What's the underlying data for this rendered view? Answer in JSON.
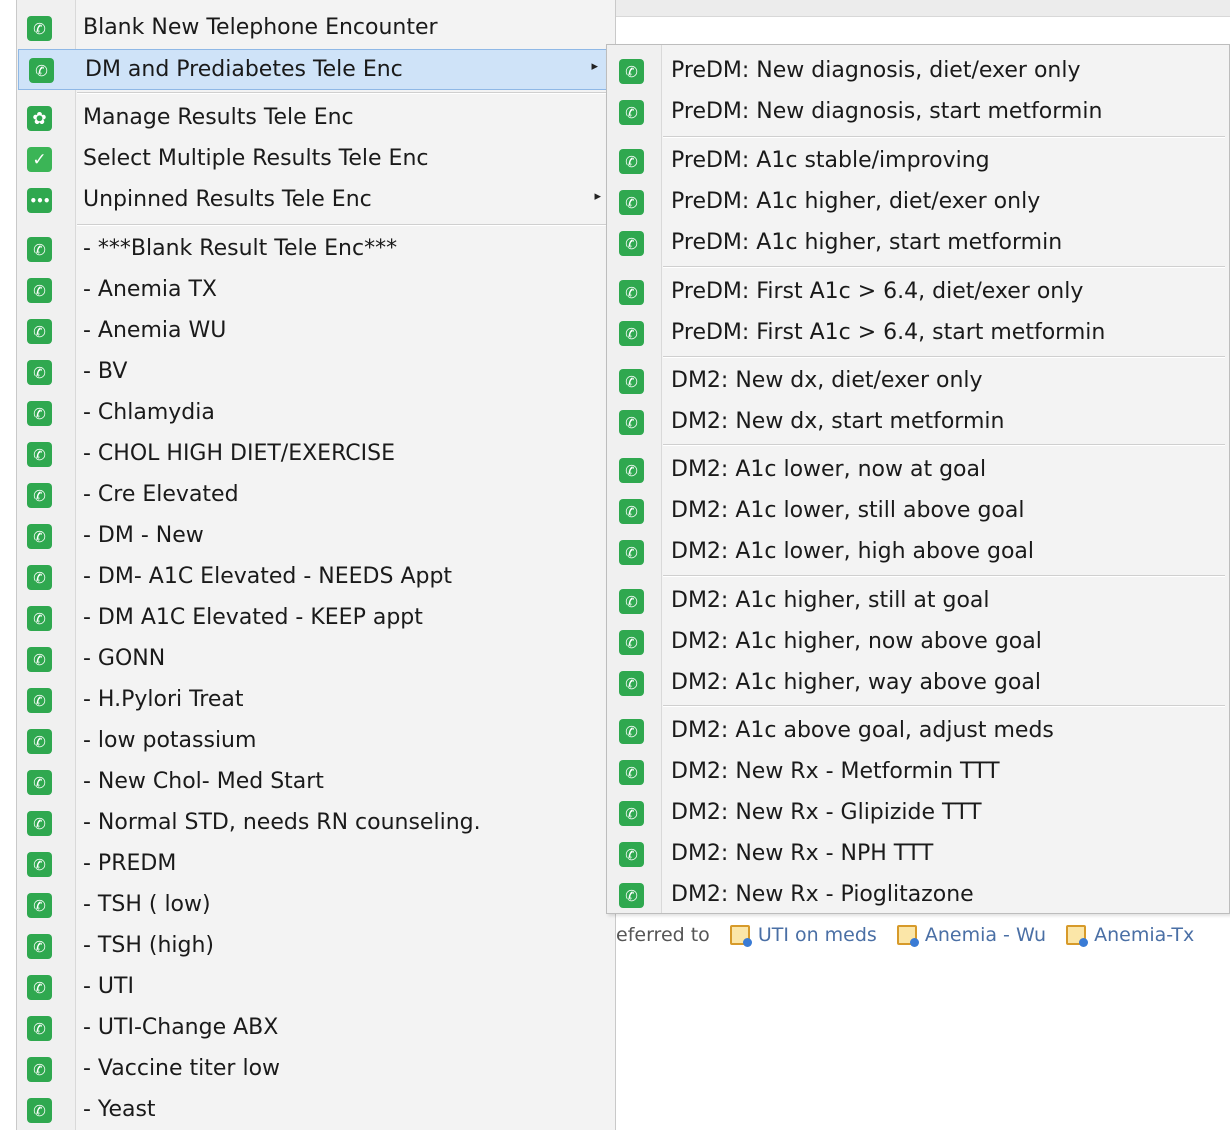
{
  "background": {
    "partial_text": "eferred to",
    "quick_items": [
      {
        "label": "UTI on meds"
      },
      {
        "label": "Anemia - Wu"
      },
      {
        "label": "Anemia-Tx"
      }
    ]
  },
  "menu": {
    "items": [
      {
        "label": "Blank New Telephone Encounter",
        "icon": "phone-icon"
      },
      {
        "label": "DM and Prediabetes Tele Enc",
        "icon": "phone-icon",
        "highlighted": true,
        "submenu_arrow": "▸"
      },
      {
        "label": "Manage Results Tele Enc",
        "icon": "gear-icon"
      },
      {
        "label": "Select Multiple Results Tele Enc",
        "icon": "check-icon"
      },
      {
        "label": "Unpinned Results Tele Enc",
        "icon": "dots-icon",
        "submenu_arrow": "▸"
      },
      {
        "label": "- ***Blank Result Tele Enc***",
        "icon": "phone-icon"
      },
      {
        "label": "- Anemia TX",
        "icon": "phone-icon"
      },
      {
        "label": "- Anemia WU",
        "icon": "phone-icon"
      },
      {
        "label": "- BV",
        "icon": "phone-icon"
      },
      {
        "label": "- Chlamydia",
        "icon": "phone-icon"
      },
      {
        "label": "- CHOL HIGH DIET/EXERCISE",
        "icon": "phone-icon"
      },
      {
        "label": "- Cre Elevated",
        "icon": "phone-icon"
      },
      {
        "label": "- DM - New",
        "icon": "phone-icon"
      },
      {
        "label": "- DM- A1C  Elevated - NEEDS  Appt",
        "icon": "phone-icon"
      },
      {
        "label": "- DM A1C Elevated - KEEP appt",
        "icon": "phone-icon"
      },
      {
        "label": "- GONN",
        "icon": "phone-icon"
      },
      {
        "label": "- H.Pylori Treat",
        "icon": "phone-icon"
      },
      {
        "label": "- low potassium",
        "icon": "phone-icon"
      },
      {
        "label": "- New Chol- Med Start",
        "icon": "phone-icon"
      },
      {
        "label": "- Normal STD, needs RN counseling.",
        "icon": "phone-icon"
      },
      {
        "label": "- PREDM",
        "icon": "phone-icon"
      },
      {
        "label": "- TSH ( low)",
        "icon": "phone-icon"
      },
      {
        "label": "- TSH (high)",
        "icon": "phone-icon"
      },
      {
        "label": "- UTI",
        "icon": "phone-icon"
      },
      {
        "label": "- UTI-Change ABX",
        "icon": "phone-icon"
      },
      {
        "label": "- Vaccine titer low",
        "icon": "phone-icon"
      },
      {
        "label": "- Yeast",
        "icon": "phone-icon"
      }
    ]
  },
  "submenu": {
    "items": [
      {
        "label": "PreDM: New diagnosis, diet/exer only",
        "icon": "phone-icon"
      },
      {
        "label": "PreDM: New diagnosis, start metformin",
        "icon": "phone-icon"
      },
      {
        "label": "PreDM: A1c stable/improving",
        "icon": "phone-icon"
      },
      {
        "label": "PreDM: A1c higher, diet/exer only",
        "icon": "phone-icon"
      },
      {
        "label": "PreDM: A1c higher, start metformin",
        "icon": "phone-icon"
      },
      {
        "label": "PreDM: First A1c > 6.4, diet/exer only",
        "icon": "phone-icon"
      },
      {
        "label": "PreDM: First A1c > 6.4, start metformin",
        "icon": "phone-icon"
      },
      {
        "label": "DM2: New dx, diet/exer only",
        "icon": "phone-icon"
      },
      {
        "label": "DM2: New dx, start metformin",
        "icon": "phone-icon"
      },
      {
        "label": "DM2: A1c lower, now at goal",
        "icon": "phone-icon"
      },
      {
        "label": "DM2: A1c lower, still above goal",
        "icon": "phone-icon"
      },
      {
        "label": "DM2: A1c lower, high above goal",
        "icon": "phone-icon"
      },
      {
        "label": "DM2: A1c higher, still at goal",
        "icon": "phone-icon"
      },
      {
        "label": "DM2: A1c higher, now above goal",
        "icon": "phone-icon"
      },
      {
        "label": "DM2: A1c higher, way above goal",
        "icon": "phone-icon"
      },
      {
        "label": "DM2: A1c above goal, adjust meds",
        "icon": "phone-icon"
      },
      {
        "label": "DM2: New Rx - Metformin TTT",
        "icon": "phone-icon"
      },
      {
        "label": "DM2: New Rx - Glipizide TTT",
        "icon": "phone-icon"
      },
      {
        "label": "DM2: New Rx - NPH TTT",
        "icon": "phone-icon"
      },
      {
        "label": "DM2: New Rx - Pioglitazone",
        "icon": "phone-icon"
      }
    ]
  },
  "colors": {
    "icon_green": "#2fa84f",
    "highlight_bg": "#cfe3f8",
    "highlight_border": "#8fb8e6",
    "menu_bg": "#f3f3f3"
  }
}
